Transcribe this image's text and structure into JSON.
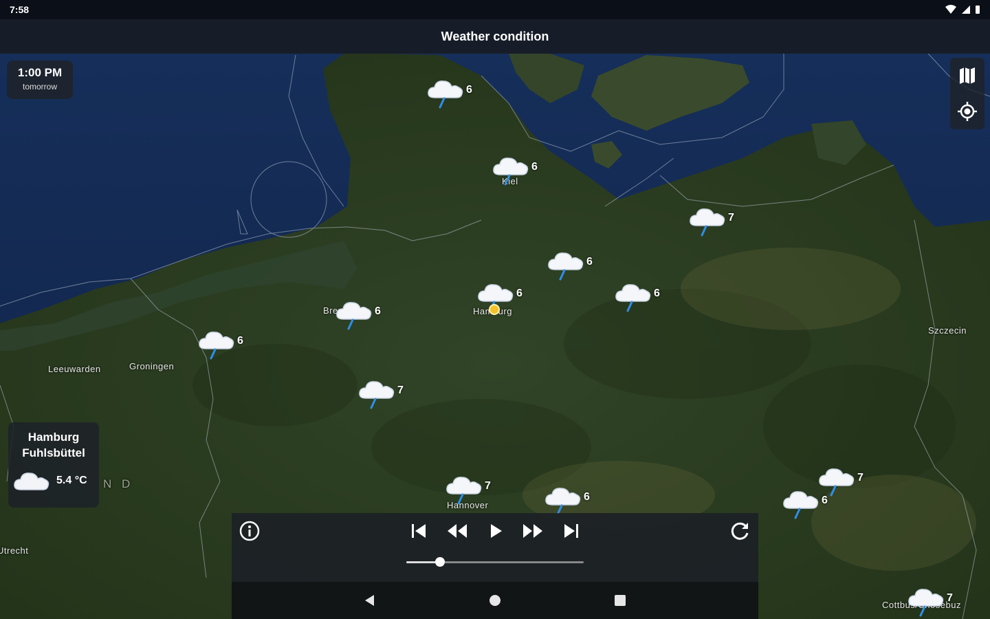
{
  "status_bar": {
    "time": "7:58"
  },
  "app_bar": {
    "title": "Weather condition"
  },
  "time_chip": {
    "time": "1:00 PM",
    "day": "tomorrow"
  },
  "map_controls": {
    "layers_icon": "map-icon",
    "locate_icon": "my-location-icon"
  },
  "markers": [
    {
      "id": "north-frisia",
      "temp": "6",
      "condition": "cloud-rain-icon"
    },
    {
      "id": "kiel",
      "temp": "6",
      "condition": "cloud-rain-icon"
    },
    {
      "id": "rostock",
      "temp": "7",
      "condition": "cloud-rain-icon"
    },
    {
      "id": "luebeck",
      "temp": "6",
      "condition": "cloud-rain-icon"
    },
    {
      "id": "hamburg",
      "temp": "6",
      "condition": "cloud-rain-icon"
    },
    {
      "id": "schwerin",
      "temp": "6",
      "condition": "cloud-rain-icon"
    },
    {
      "id": "bremen",
      "temp": "6",
      "condition": "cloud-rain-icon"
    },
    {
      "id": "emden",
      "temp": "6",
      "condition": "cloud-rain-icon"
    },
    {
      "id": "oldenburg-south",
      "temp": "7",
      "condition": "cloud-rain-icon"
    },
    {
      "id": "hannover",
      "temp": "7",
      "condition": "cloud-rain-icon"
    },
    {
      "id": "braunschweig",
      "temp": "6",
      "condition": "cloud-rain-icon"
    },
    {
      "id": "berlin-north",
      "temp": "7",
      "condition": "cloud-rain-icon"
    },
    {
      "id": "potsdam",
      "temp": "6",
      "condition": "cloud-rain-icon"
    },
    {
      "id": "cottbus",
      "temp": "7",
      "condition": "cloud-rain-icon"
    }
  ],
  "city_labels": {
    "kiel": "Kiel",
    "hamburg": "Hamburg",
    "bremen": "Bremen",
    "hannover": "Hannover",
    "szczecin": "Szczecin",
    "leeuwarden": "Leeuwarden",
    "groningen": "Groningen",
    "utrecht": "Utrecht",
    "cottbus": "Cottbus/Chóśebuz",
    "nd": "N D"
  },
  "station_card": {
    "name": "Hamburg Fuhlsbüttel",
    "temperature": "5.4 °C",
    "condition": "cloud-icon"
  },
  "player": {
    "info_icon": "info-icon",
    "skip_start_icon": "skip-previous-icon",
    "rewind_icon": "rewind-icon",
    "play_icon": "play-icon",
    "fast_forward_icon": "fast-forward-icon",
    "skip_end_icon": "skip-next-icon",
    "refresh_icon": "refresh-icon",
    "progress": 0.19
  },
  "nav_bar": {
    "back_icon": "back-icon",
    "home_icon": "home-icon",
    "recents_icon": "recents-icon"
  },
  "colors": {
    "sea": "#13294f",
    "land": "#2b3d22",
    "status_bar": "#0b0f17",
    "marker_sun": "#f5c12a"
  }
}
